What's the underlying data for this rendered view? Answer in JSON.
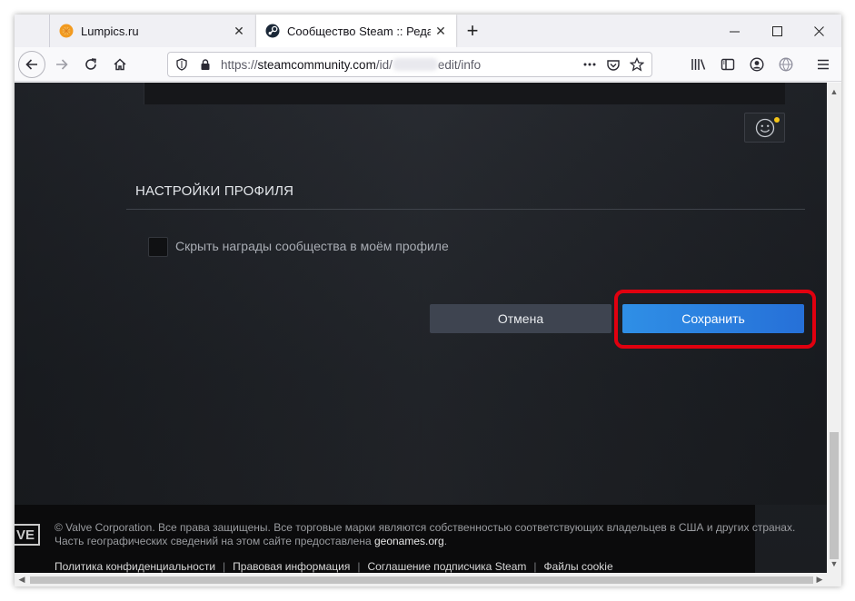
{
  "browser": {
    "tabs": [
      {
        "title": "Lumpics.ru",
        "icon": "lumpics-favicon",
        "active": false
      },
      {
        "title": "Сообщество Steam :: Редактир",
        "icon": "steam-favicon",
        "active": true
      }
    ],
    "new_tab": "+",
    "window_controls": {
      "minimize": "—",
      "maximize": "☐",
      "close": "✕"
    },
    "url": {
      "prefix": "https://",
      "domain": "steamcommunity.com",
      "path_start": "/id/",
      "path_end": "edit/info"
    },
    "menu": "☰"
  },
  "page": {
    "section_title": "НАСТРОЙКИ ПРОФИЛЯ",
    "checkbox_label": "Скрыть награды сообщества в моём профиле",
    "checkbox_checked": false,
    "cancel_label": "Отмена",
    "save_label": "Сохранить",
    "highlight_color": "#e1000f",
    "save_color": "#2f8fe6"
  },
  "footer": {
    "logo": "VE",
    "copyright": "© Valve Corporation. Все права защищены. Все торговые марки являются собственностью соответствующих владельцев в США и других странах.",
    "geo_prefix": "Часть географических сведений на этом сайте предоставлена ",
    "geo_link": "geonames.org",
    "geo_suffix": ".",
    "links": [
      "Политика конфиденциальности",
      "Правовая информация",
      "Соглашение подписчика Steam",
      "Файлы cookie"
    ],
    "separator": "|"
  }
}
